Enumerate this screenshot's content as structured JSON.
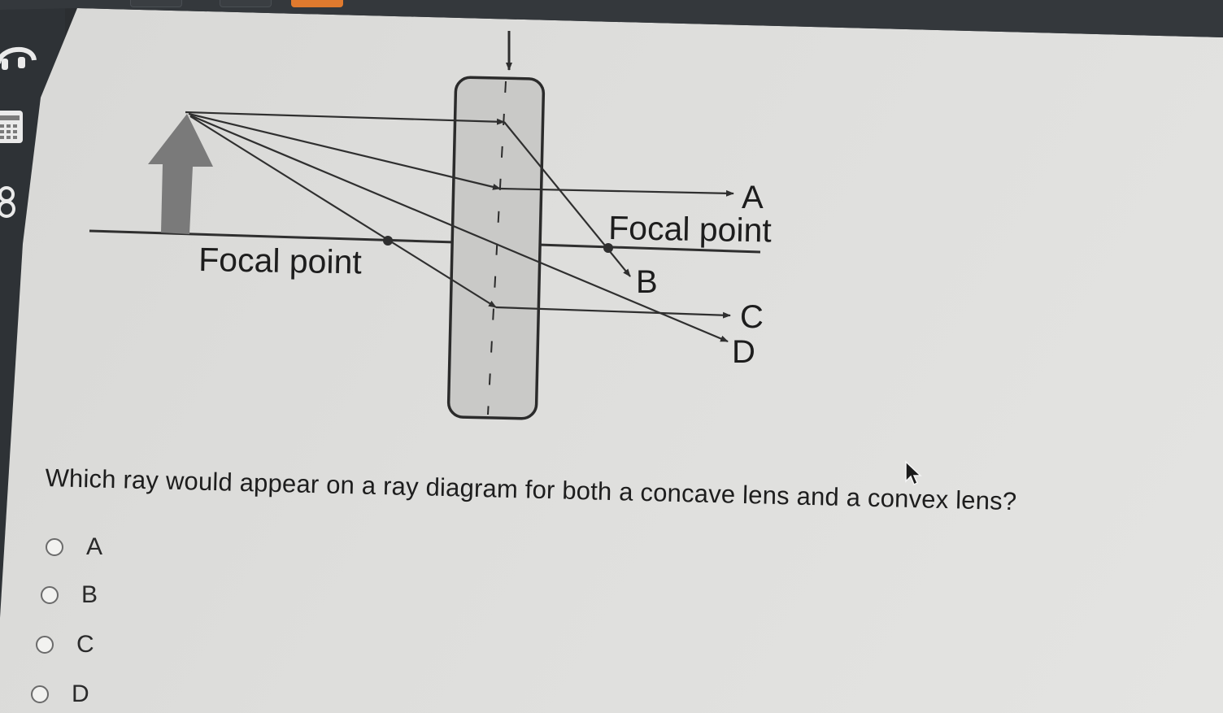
{
  "rail": {
    "icons": [
      "headphones-icon",
      "calculator-icon",
      "reference-icon"
    ]
  },
  "diagram": {
    "focal_left_label": "Focal point",
    "focal_right_label": "Focal point",
    "ray_labels": [
      "A",
      "B",
      "C",
      "D"
    ]
  },
  "question": {
    "text": "Which ray would appear on a ray diagram for both a concave lens and a convex lens?",
    "options": [
      {
        "label": "A"
      },
      {
        "label": "B"
      },
      {
        "label": "C"
      },
      {
        "label": "D"
      }
    ],
    "selected": null
  },
  "colors": {
    "object_arrow": "#7a7a7a",
    "lens_fill": "#c9c9c7",
    "ray": "#2f2f2f",
    "text": "#1d1d1d"
  }
}
